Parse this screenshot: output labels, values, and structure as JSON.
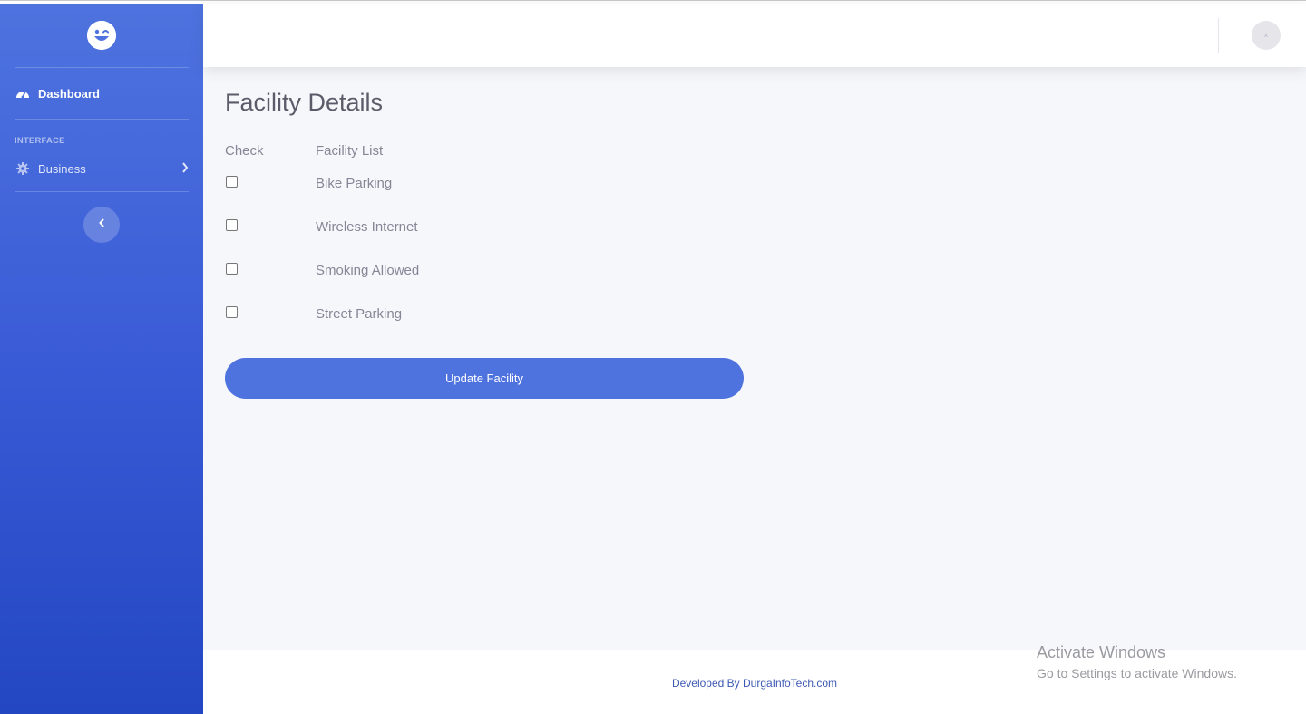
{
  "sidebar": {
    "brand_icon": "smiley-logo-icon",
    "items": [
      {
        "label": "Dashboard",
        "icon": "tachometer-icon"
      },
      {
        "label": "Business",
        "icon": "gear-icon"
      }
    ],
    "heading": "INTERFACE",
    "toggle_icon": "chevron-left-icon"
  },
  "topbar": {
    "avatar_text": "×"
  },
  "main": {
    "title": "Facility Details",
    "columns": {
      "check": "Check",
      "facility": "Facility List"
    },
    "facilities": [
      {
        "name": "Bike Parking",
        "checked": false
      },
      {
        "name": "Wireless Internet",
        "checked": false
      },
      {
        "name": "Smoking Allowed",
        "checked": false
      },
      {
        "name": "Street Parking",
        "checked": false
      }
    ],
    "button_label": "Update Facility"
  },
  "footer": {
    "credit": "Developed By DurgaInfoTech.com"
  },
  "watermark": {
    "line1": "Activate Windows",
    "line2": "Go to Settings to activate Windows."
  },
  "colors": {
    "primary": "#4e73df",
    "sidebar_bottom": "#2346c2",
    "content_bg": "#f6f7fb",
    "text_gray": "#858796"
  }
}
